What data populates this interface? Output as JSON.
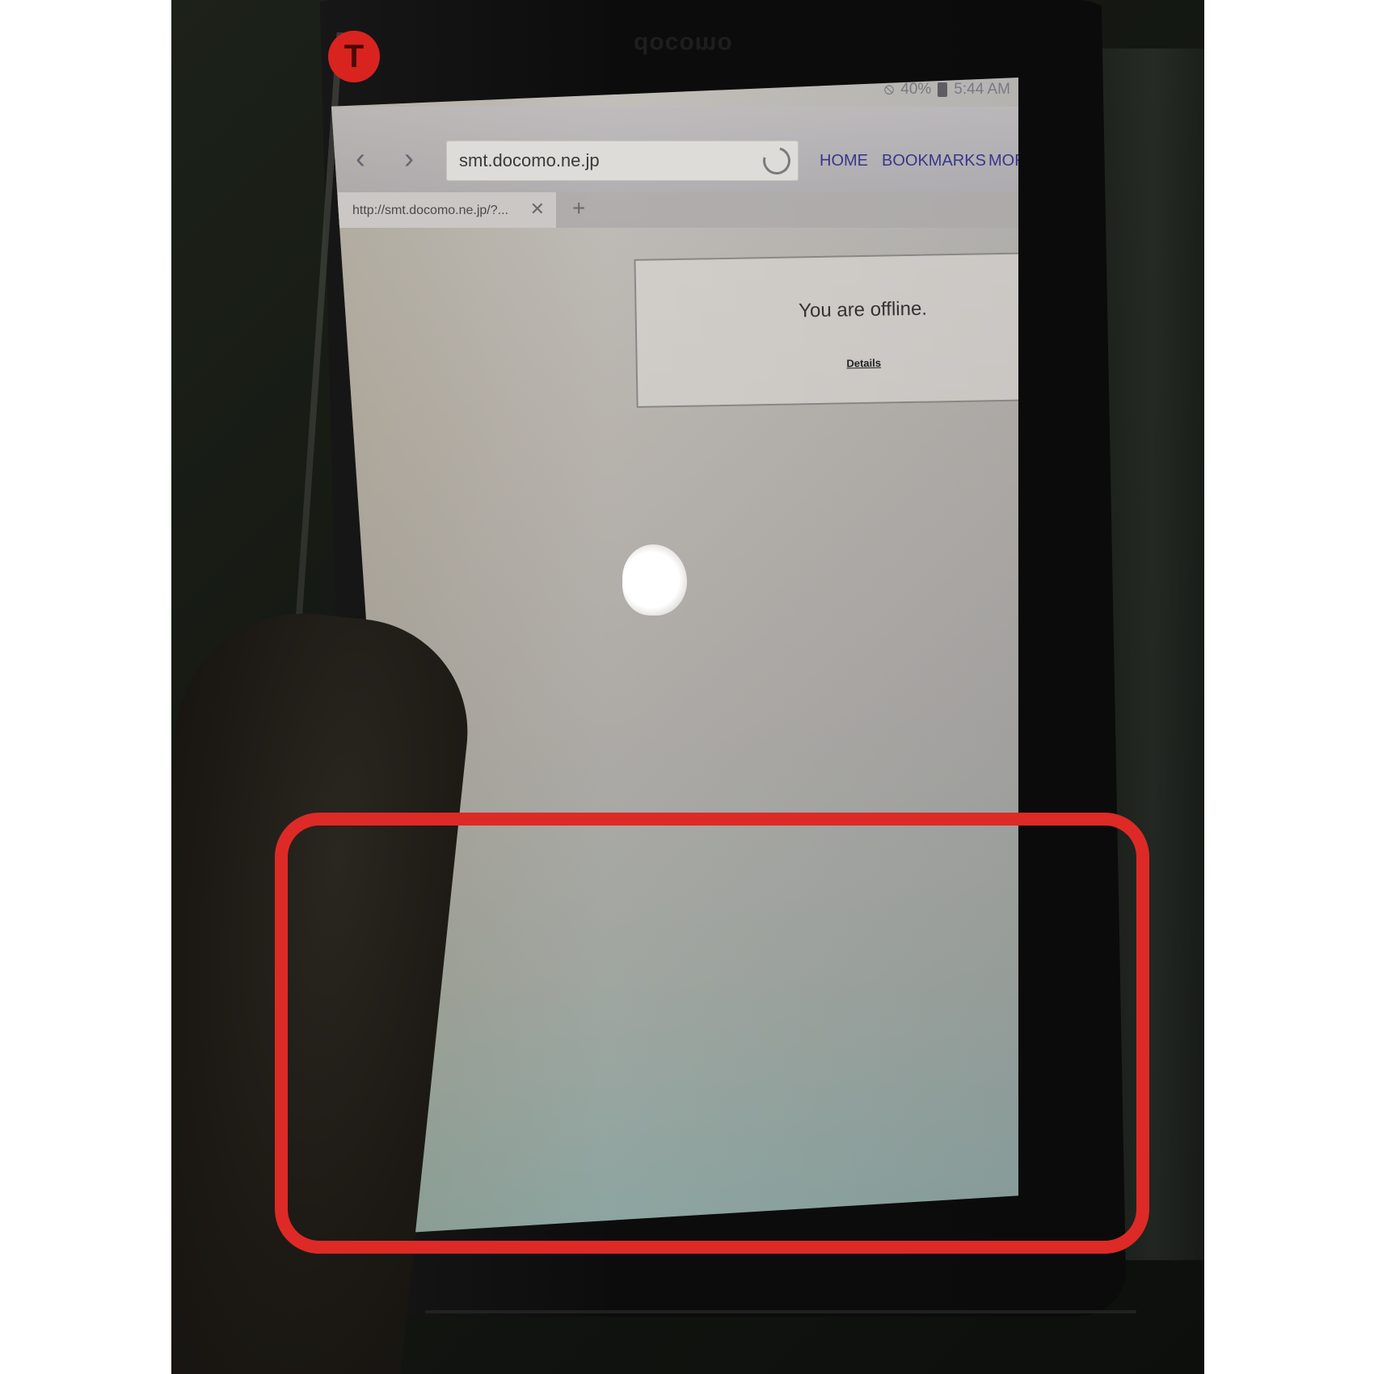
{
  "device": {
    "brand": "docomo",
    "marker_label": "T"
  },
  "status_bar": {
    "battery": "40%",
    "time": "5:44 AM",
    "icons": [
      "do-not-disturb-icon",
      "battery-icon"
    ]
  },
  "browser": {
    "url": "smt.docomo.ne.jp",
    "menu": {
      "home": "HOME",
      "bookmarks": "BOOKMARKS",
      "more": "MORE"
    },
    "tabs": [
      {
        "title": "http://smt.docomo.ne.jp/?..."
      }
    ],
    "new_tab_label": "+",
    "close_tab_label": "✕",
    "back_label": "‹",
    "forward_label": "›"
  },
  "page": {
    "offline_message": "You are offline.",
    "details_link": "Details"
  },
  "colors": {
    "highlight": "#dd2a26",
    "link": "#37378a"
  }
}
